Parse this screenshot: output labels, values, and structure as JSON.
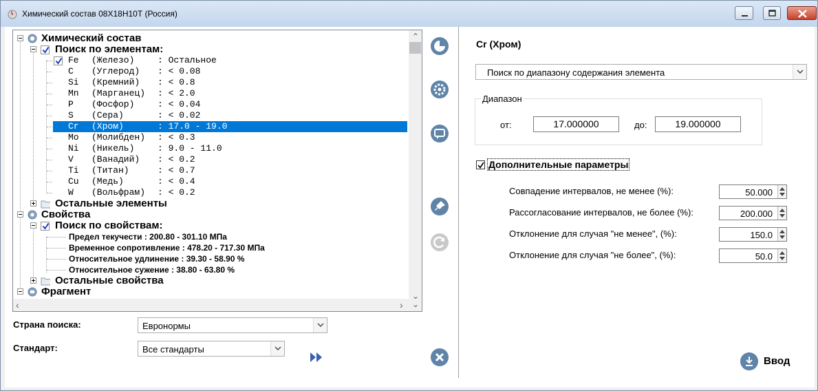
{
  "window": {
    "title": "Химический состав 08Х18Н10Т (Россия)"
  },
  "tree": {
    "chem_root": "Химический состав",
    "search_by_elements": "Поиск по элементам:",
    "elements": [
      {
        "sym": "Fe",
        "name": "(Железо)",
        "value": ": Остальное"
      },
      {
        "sym": "C",
        "name": "(Углерод)",
        "value": ": < 0.08"
      },
      {
        "sym": "Si",
        "name": "(Кремний)",
        "value": ": < 0.8"
      },
      {
        "sym": "Mn",
        "name": "(Марганец)",
        "value": ": < 2.0"
      },
      {
        "sym": "P",
        "name": "(Фосфор)",
        "value": ": < 0.04"
      },
      {
        "sym": "S",
        "name": "(Сера)",
        "value": ": < 0.02"
      },
      {
        "sym": "Cr",
        "name": "(Хром)",
        "value": ": 17.0 - 19.0"
      },
      {
        "sym": "Mo",
        "name": "(Молибден)",
        "value": ": < 0.3"
      },
      {
        "sym": "Ni",
        "name": "(Никель)",
        "value": ": 9.0 - 11.0"
      },
      {
        "sym": "V",
        "name": "(Ванадий)",
        "value": ": < 0.2"
      },
      {
        "sym": "Ti",
        "name": "(Титан)",
        "value": ": < 0.7"
      },
      {
        "sym": "Cu",
        "name": "(Медь)",
        "value": ": < 0.4"
      },
      {
        "sym": "W",
        "name": "(Вольфрам)",
        "value": ": < 0.2"
      }
    ],
    "selected_element_index": 6,
    "other_elements": "Остальные элементы",
    "props_root": "Свойства",
    "search_by_props": "Поиск по свойствам:",
    "properties": [
      "Предел текучести : 200.80 - 301.10 МПа",
      "Временное сопротивление : 478.20 - 717.30 МПа",
      "Относительное удлинение : 39.30 - 58.90 %",
      "Относительное сужение : 38.80 - 63.80 %"
    ],
    "other_props": "Остальные свойства",
    "fragment_root": "Фрагмент"
  },
  "search": {
    "country_label": "Страна поиска:",
    "country_value": "Евронормы",
    "standard_label": "Стандарт:",
    "standard_value": "Все стандарты"
  },
  "right": {
    "element_title": "Cr  (Хром)",
    "mode_value": "Поиск по диапазону содержания элемента",
    "range_legend": "Диапазон",
    "from_label": "от:",
    "from_value": "17.000000",
    "to_label": "до:",
    "to_value": "19.000000",
    "extra_params_label": "Дополнительные параметры",
    "extra_params_checked": true,
    "params": [
      {
        "label": "Совпадение интервалов, не менее (%):",
        "value": "50.000"
      },
      {
        "label": "Рассогласование интервалов, не более (%):",
        "value": "200.000"
      },
      {
        "label": "Отклонение для случая \"не менее\", (%):",
        "value": "150.0"
      },
      {
        "label": "Отклонение для случая \"не более\", (%):",
        "value": "50.0"
      }
    ],
    "enter_label": "Ввод"
  },
  "colors": {
    "selection": "#0078d7",
    "toolbar_icon": "#5f84a8",
    "check": "#1a3fc4"
  }
}
